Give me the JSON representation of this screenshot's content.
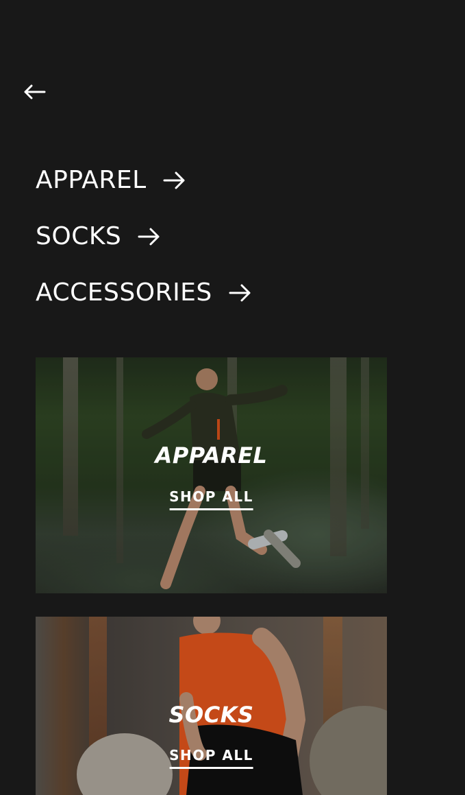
{
  "back": {
    "icon": "arrow-left-icon"
  },
  "menu": {
    "items": [
      {
        "label": "APPAREL",
        "icon": "arrow-right-icon"
      },
      {
        "label": "SOCKS",
        "icon": "arrow-right-icon"
      },
      {
        "label": "ACCESSORIES",
        "icon": "arrow-right-icon"
      }
    ]
  },
  "cards": [
    {
      "title": "APPAREL",
      "cta": "SHOP ALL"
    },
    {
      "title": "SOCKS",
      "cta": "SHOP ALL"
    }
  ],
  "colors": {
    "background": "#181818",
    "text": "#ffffff"
  }
}
